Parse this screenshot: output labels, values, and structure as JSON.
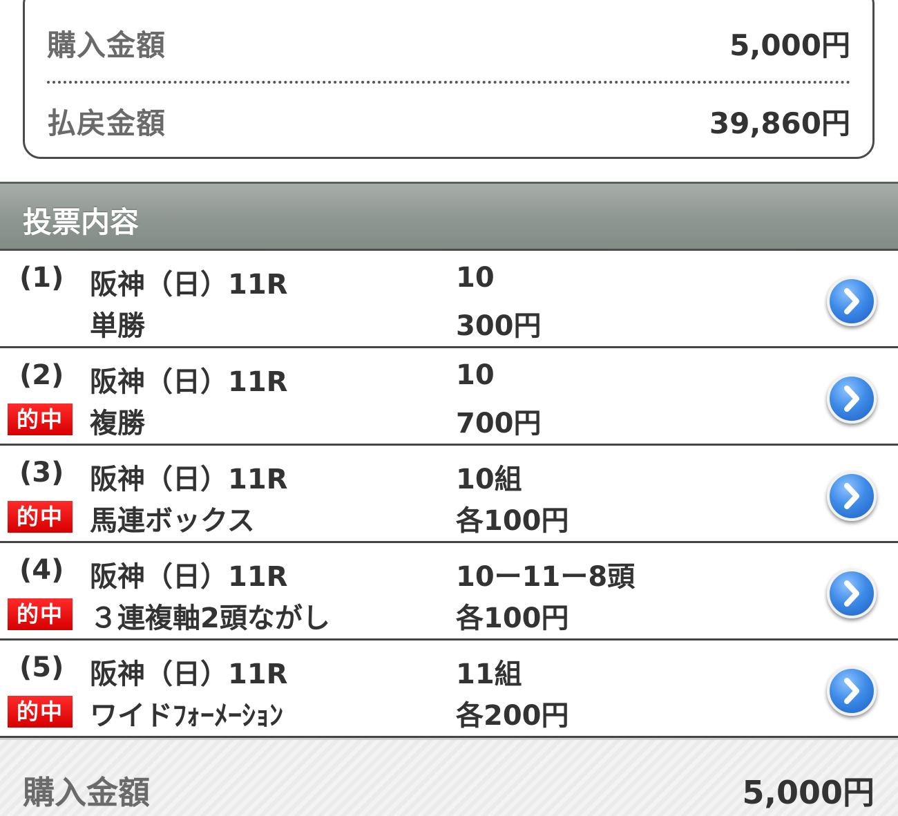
{
  "summary": {
    "purchase_label": "購入金額",
    "purchase_value": "5,000円",
    "payout_label": "払戻金額",
    "payout_value": "39,860円"
  },
  "section": {
    "title": "投票内容"
  },
  "bets": [
    {
      "num": "(1)",
      "race": "阪神（日）11R",
      "type": "単勝",
      "combo": "10",
      "amount": "300円",
      "hit": ""
    },
    {
      "num": "(2)",
      "race": "阪神（日）11R",
      "type": "複勝",
      "combo": "10",
      "amount": "700円",
      "hit": "的中"
    },
    {
      "num": "(3)",
      "race": "阪神（日）11R",
      "type": "馬連ボックス",
      "combo": "10組",
      "amount": "各100円",
      "hit": "的中"
    },
    {
      "num": "(4)",
      "race": "阪神（日）11R",
      "type": "３連複軸2頭ながし",
      "combo": "10ー11ー8頭",
      "amount": "各100円",
      "hit": "的中"
    },
    {
      "num": "(5)",
      "race": "阪神（日）11R",
      "type": "ワイドﾌｫｰﾒｰｼｮﾝ",
      "combo": "11組",
      "amount": "各200円",
      "hit": "的中"
    }
  ],
  "footer": {
    "purchase_label": "購入金額",
    "purchase_value": "5,000円"
  },
  "colors": {
    "hit_badge": "#e00000",
    "header_bar": "#949c97",
    "detail_button": "#2f7be0"
  },
  "icons": {
    "detail": "chevron-right-icon"
  }
}
